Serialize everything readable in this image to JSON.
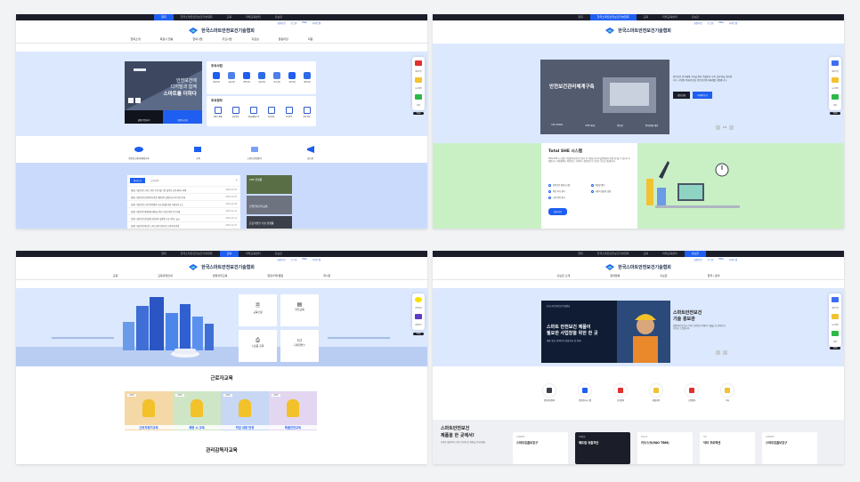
{
  "p1": {
    "topbar": [
      "협회",
      "한국스마트안전보건기술협회",
      "교육",
      "미래교육센터",
      "홍보관"
    ],
    "util": [
      "회원가입",
      "로그인",
      "ENG",
      "사이트맵"
    ],
    "logo": "한국스마트안전보건기술협회",
    "nav": [
      "협회소개",
      "회원사 현황",
      "협회사업",
      "주요사업",
      "자료실",
      "알림마당",
      "회원"
    ],
    "hero_line1": "안전보건에",
    "hero_line2": "디지털과 함께",
    "hero_line3": "스마트를 더하다",
    "counter": "1",
    "hero_btn_left": "회원가입하기",
    "hero_btn_right": "회원사조회",
    "main_biz_title": "주요사업",
    "main_biz": [
      "정보공유",
      "교육사업",
      "인증사업",
      "홍보사업",
      "연구사업",
      "교류사업",
      "정책사업"
    ],
    "main_info_title": "주요정보",
    "main_info": [
      "회원사 제품",
      "홍보자료",
      "기술&제품소개",
      "보도자료",
      "공지사항",
      "회원 정보"
    ],
    "quick": [
      "안전보건관리체계구축",
      "교육",
      "스마트안전장비",
      "홍보관"
    ],
    "tabs": [
      "협회소식",
      "공지사항"
    ],
    "news": [
      {
        "t": "[협회 기술동향] 스마트 안전 보건기술 기반 솔루션 공유 세미나 개최",
        "d": "2024.12.10"
      },
      {
        "t": "[협회 기술동향] 산업안전보건법 개정사항 설명회 참가자 모집 안내",
        "d": "2024.12.05"
      },
      {
        "t": "[회원 기술동향] 스마트안전장비 보급 확대를 위한 지원사업 공고",
        "d": "2024.11.28"
      },
      {
        "t": "[회원 기술동향] 중대재해 예방을 위한 디지털 전환 우수사례",
        "d": "2024.11.21"
      },
      {
        "t": "[회원 기술동향] 건설현장 안전관리 플랫폼 신규 서비스 출시",
        "d": "2024.11.14"
      },
      {
        "t": "[회원 기술동향] 제조업 스마트공장 안전보건 교육과정 안내",
        "d": "2024.11.07"
      }
    ],
    "side_cards": [
      "SHE 플랫폼",
      "산업안전관리교육",
      "근로자안전 기술 플랫폼"
    ]
  },
  "p2": {
    "topbar": [
      "협회",
      "한국스마트안전보건기술협회",
      "교육",
      "미래교육센터",
      "홍보관"
    ],
    "util": [
      "회원가입",
      "로그인",
      "ENG",
      "사이트맵"
    ],
    "logo": "한국스마트안전보건기술협회",
    "hero_title": "안전보건관리체계구축",
    "hero_tabs": [
      "ISO 45001",
      "SHE 체계",
      "위험성",
      "중대재해 예방"
    ],
    "hero_desc": "안전보건 관리체계 구축을 위한 컨설팅과 교육, 솔루션을 제공합니다. 사업장 특성에 맞춘 안전보건관리체계를 지원합니다.",
    "btn_consult": "상담신청",
    "btn_more": "자세히보기",
    "counter": "1/3",
    "she_title": "Total SHE 시스템",
    "she_desc": "Total SHE 시스템은 사업장의 안전보건 관리 전 과정을 하나의 플랫폼에서 통합 관리할 수 있도록 지원합니다. 위험성평가, 작업허가, 교육관리, 점검관리 등 다양한 기능을 제공합니다.",
    "she_items": [
      "안전보건 경영시스템",
      "위험성 평가",
      "작업 허가 관리",
      "사용자 맞춤형 설정",
      "교육 이력 관리"
    ],
    "she_btn": "상담하기"
  },
  "p3": {
    "topbar": [
      "협회",
      "한국스마트안전보건기술협회",
      "교육",
      "미래교육센터",
      "홍보관"
    ],
    "util": [
      "회원가입",
      "로그인",
      "ENG",
      "사이트맵"
    ],
    "logo": "한국스마트안전보건기술협회",
    "nav": [
      "교육",
      "교육과정안내",
      "법정의무교육",
      "일정/커리큘럼",
      "게시판"
    ],
    "edu_cards": [
      "교육신청",
      "안전교육",
      "수료증 출력",
      "디지털연수"
    ],
    "worker_title": "근로자교육",
    "courses": [
      {
        "badge": "근로자",
        "t": "근로자정기교육"
      },
      {
        "badge": "근로자",
        "t": "채용 시 교육"
      },
      {
        "badge": "근로자",
        "t": "작업 내용 변경"
      },
      {
        "badge": "근로자",
        "t": "특별안전교육"
      }
    ],
    "manager_title": "관리감독자교육",
    "floater": [
      "카카오톡",
      "문의하기"
    ]
  },
  "p4": {
    "topbar": [
      "협회",
      "한국스마트안전보건기술협회",
      "교육",
      "미래교육센터",
      "홍보관"
    ],
    "util": [
      "회원가입",
      "로그인",
      "ENG",
      "사이트맵"
    ],
    "logo": "한국스마트안전보건기술협회",
    "nav": [
      "홍보관 소개",
      "참여업체",
      "홍보관",
      "협력 / 문의"
    ],
    "hero_line1": "스마트 안전보건 제품이",
    "hero_line2": "필요한 사업장을 위한 한 곳",
    "hero_sub": "제품 정보 검색부터 상담까지 한 번에",
    "hero_tag": "한국스마트안전보건기술협회",
    "hall_title1": "스마트안전보건",
    "hall_title2": "기술 홍보관",
    "hall_desc": "회원사의 우수한 스마트 안전보건 제품과 기술을 한 곳에서 만나보실 수 있습니다.",
    "categories": [
      "안전관리장비",
      "안전관리시스템",
      "보호장비",
      "환경측정",
      "소방장비",
      "기타"
    ],
    "promo_title1": "스마트안전보건",
    "promo_title2": "제품을 한 곳에서!",
    "promo_desc": "다양한 회원사의 스마트 안전보건 제품을 만나보세요.",
    "products": [
      {
        "co": "스마트안전",
        "t": "스마트호흡보호구",
        "dark": false
      },
      {
        "co": "유해물질",
        "t": "페트럼 유출차단",
        "dark": true
      },
      {
        "co": "키오스크",
        "t": "키오스크(MJO TBM)",
        "dark": false
      },
      {
        "co": "닥터",
        "t": "닥터 프로텍션",
        "dark": false
      },
      {
        "co": "스마트안전",
        "t": "스마트호흡보호구",
        "dark": false
      }
    ]
  },
  "floater": {
    "a": "회원가입",
    "b": "뉴스레터",
    "c": "문의",
    "top": "TOP"
  },
  "colors": {
    "primary": "#1e5ef0",
    "dark": "#1b1e29",
    "lightblue": "#dbe8fd",
    "green": "#c9f0c5"
  }
}
